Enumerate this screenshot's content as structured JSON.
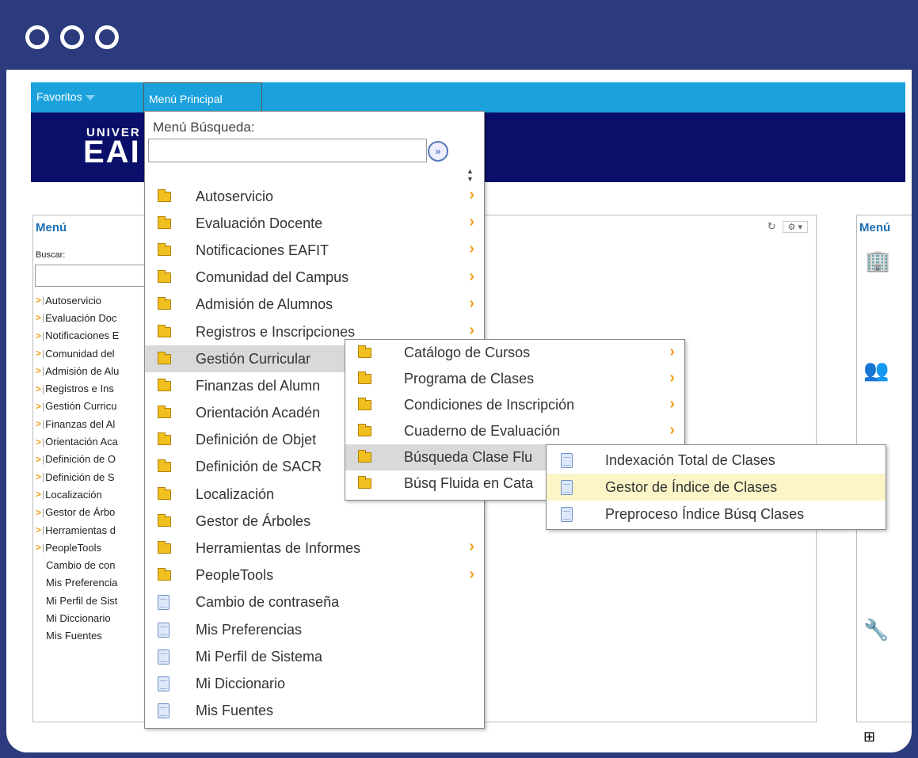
{
  "topbar": {
    "favorites": "Favoritos",
    "main_menu": "Menú Principal"
  },
  "banner": {
    "logo_line1": "UNIVER",
    "logo_line2": "EAI"
  },
  "left_panel": {
    "title": "Menú",
    "search_label": "Buscar:",
    "items": [
      {
        "label": "Autoservicio",
        "folder": true
      },
      {
        "label": "Evaluación Doc",
        "folder": true
      },
      {
        "label": "Notificaciones E",
        "folder": true
      },
      {
        "label": "Comunidad del",
        "folder": true
      },
      {
        "label": "Admisión de Alu",
        "folder": true
      },
      {
        "label": "Registros e Ins",
        "folder": true
      },
      {
        "label": "Gestión Curricu",
        "folder": true
      },
      {
        "label": "Finanzas del Al",
        "folder": true
      },
      {
        "label": "Orientación Aca",
        "folder": true
      },
      {
        "label": "Definición de O",
        "folder": true
      },
      {
        "label": "Definición de S",
        "folder": true
      },
      {
        "label": "Localización",
        "folder": true
      },
      {
        "label": "Gestor de Árbo",
        "folder": true
      },
      {
        "label": "Herramientas d",
        "folder": true
      },
      {
        "label": "PeopleTools",
        "folder": true
      },
      {
        "label": "Cambio de con",
        "folder": false
      },
      {
        "label": "Mis Preferencia",
        "folder": false
      },
      {
        "label": "Mi Perfil de Sist",
        "folder": false
      },
      {
        "label": "Mi Diccionario",
        "folder": false
      },
      {
        "label": "Mis Fuentes",
        "folder": false
      }
    ]
  },
  "right_panel": {
    "title": "Menú"
  },
  "dropdown": {
    "title": "Menú Búsqueda:",
    "go_label": "»",
    "items": [
      {
        "label": "Autoservicio",
        "type": "folder",
        "arrow": true
      },
      {
        "label": "Evaluación Docente",
        "type": "folder",
        "arrow": true
      },
      {
        "label": "Notificaciones EAFIT",
        "type": "folder",
        "arrow": true
      },
      {
        "label": "Comunidad del Campus",
        "type": "folder",
        "arrow": true
      },
      {
        "label": "Admisión de Alumnos",
        "type": "folder",
        "arrow": true
      },
      {
        "label": "Registros e Inscripciones",
        "type": "folder",
        "arrow": true
      },
      {
        "label": "Gestión Curricular",
        "type": "folder",
        "arrow": false
      },
      {
        "label": "Finanzas del Alumn",
        "type": "folder",
        "arrow": false
      },
      {
        "label": "Orientación Acadén",
        "type": "folder",
        "arrow": false
      },
      {
        "label": "Definición de Objet",
        "type": "folder",
        "arrow": false
      },
      {
        "label": "Definición de SACR",
        "type": "folder",
        "arrow": false
      },
      {
        "label": "Localización",
        "type": "folder",
        "arrow": false
      },
      {
        "label": "Gestor de Árboles",
        "type": "folder",
        "arrow": false
      },
      {
        "label": "Herramientas de Informes",
        "type": "folder",
        "arrow": true
      },
      {
        "label": "PeopleTools",
        "type": "folder",
        "arrow": true
      },
      {
        "label": "Cambio de contraseña",
        "type": "doc",
        "arrow": false
      },
      {
        "label": "Mis Preferencias",
        "type": "doc",
        "arrow": false
      },
      {
        "label": "Mi Perfil de Sistema",
        "type": "doc",
        "arrow": false
      },
      {
        "label": "Mi Diccionario",
        "type": "doc",
        "arrow": false
      },
      {
        "label": "Mis Fuentes",
        "type": "doc",
        "arrow": false
      }
    ],
    "highlighted": "Gestión Curricular"
  },
  "submenu_curricular": {
    "items": [
      {
        "label": "Catálogo de Cursos",
        "arrow": true
      },
      {
        "label": "Programa de Clases",
        "arrow": true
      },
      {
        "label": "Condiciones de Inscripción",
        "arrow": true
      },
      {
        "label": "Cuaderno de Evaluación",
        "arrow": true
      },
      {
        "label": "Búsqueda Clase Flu",
        "arrow": false
      },
      {
        "label": "Búsq Fluida en Cata",
        "arrow": false
      }
    ],
    "highlighted": "Búsqueda Clase Flu"
  },
  "submenu_busqueda": {
    "items": [
      {
        "label": "Indexación Total de Clases"
      },
      {
        "label": "Gestor de Índice de Clases"
      },
      {
        "label": "Preproceso Índice Búsq Clases"
      }
    ],
    "highlighted": "Gestor de Índice de Clases"
  }
}
